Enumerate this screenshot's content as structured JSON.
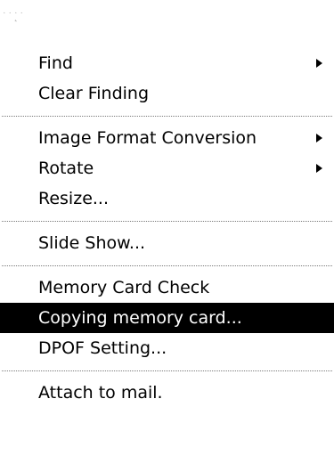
{
  "header": {
    "fragment": "˙˙˙̨̨˙"
  },
  "menu": {
    "groups": [
      [
        {
          "label": "Find",
          "submenu": true
        },
        {
          "label": "Clear Finding",
          "submenu": false
        }
      ],
      [
        {
          "label": "Image Format Conversion",
          "submenu": true
        },
        {
          "label": "Rotate",
          "submenu": true
        },
        {
          "label": "Resize...",
          "submenu": false
        }
      ],
      [
        {
          "label": "Slide Show...",
          "submenu": false
        }
      ],
      [
        {
          "label": "Memory Card Check",
          "submenu": false
        },
        {
          "label": "Copying memory card...",
          "submenu": false,
          "selected": true
        },
        {
          "label": "DPOF Setting...",
          "submenu": false
        }
      ],
      [
        {
          "label": "Attach to mail.",
          "submenu": false
        }
      ]
    ]
  },
  "colors": {
    "selection_background": "#000000",
    "selection_text": "#ffffff",
    "text": "#000000",
    "separator": "#7a7a7a"
  }
}
